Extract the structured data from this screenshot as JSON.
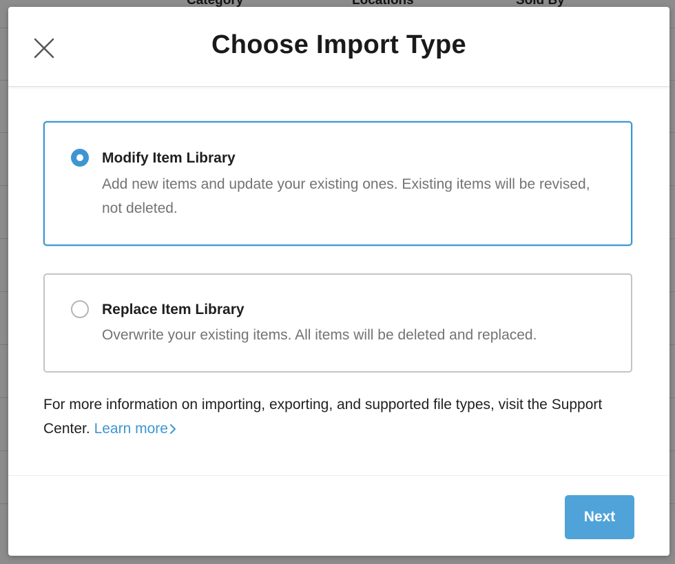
{
  "background": {
    "columns": [
      "Category",
      "Locations",
      "Sold By"
    ]
  },
  "modal": {
    "title": "Choose Import Type",
    "close_icon": "close-icon",
    "options": [
      {
        "title": "Modify Item Library",
        "description": "Add new items and update your existing ones. Existing items will be revised, not deleted.",
        "selected": true
      },
      {
        "title": "Replace Item Library",
        "description": "Overwrite your existing items. All items will be deleted and replaced.",
        "selected": false
      }
    ],
    "info_text": "For more information on importing, exporting, and supported file types, visit the Support Center.",
    "learn_more_label": "Learn more",
    "next_label": "Next"
  },
  "colors": {
    "accent": "#3d96d1",
    "button": "#4fa3d9",
    "overlay": "#8c8c8c"
  }
}
